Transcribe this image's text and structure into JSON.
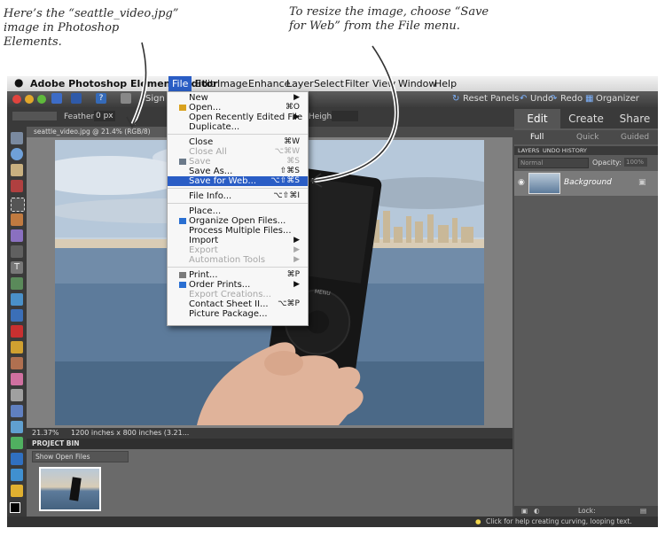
{
  "annotations": {
    "left": "Here’s the “seattle_video.jpg” image in Photoshop Elements.",
    "right": "To resize the image, choose “Save for Web” from the File menu."
  },
  "menubar": {
    "app_name": "Adobe Photoshop Elements Editor",
    "menus": [
      "File",
      "Edit",
      "Image",
      "Enhance",
      "Layer",
      "Select",
      "Filter",
      "View",
      "Window",
      "Help"
    ],
    "active_menu": "File"
  },
  "topbar": {
    "sign_in": "Sign In",
    "reset_panels": "Reset Panels",
    "undo": "Undo",
    "redo": "Redo",
    "organizer": "Organizer"
  },
  "options_bar": {
    "feather_label": "Feather:",
    "feather_value": "0 px",
    "height_label": "Height"
  },
  "document_tab": "seattle_video.jpg @ 21.4% (RGB/8)",
  "status": {
    "zoom": "21.37%",
    "dimensions": "1200 inches x 800 inches (3.21..."
  },
  "project_bin": {
    "title": "PROJECT BIN",
    "dropdown": "Show Open Files"
  },
  "right_panel": {
    "tabs": [
      "Edit",
      "Create",
      "Share"
    ],
    "subtabs": [
      "Full",
      "Quick",
      "Guided"
    ],
    "panel_tabs": [
      "LAYERS",
      "UNDO HISTORY"
    ],
    "blend_mode": "Normal",
    "opacity_label": "Opacity:",
    "opacity_value": "100%",
    "layer_name": "Background",
    "lock_label": "Lock:"
  },
  "bottom_status": "Click for help creating curving, looping text.",
  "file_menu": {
    "items": [
      {
        "label": "New",
        "shortcut": "▶",
        "state": "normal"
      },
      {
        "label": "Open...",
        "shortcut": "⌘O",
        "state": "normal"
      },
      {
        "label": "Open Recently Edited File",
        "shortcut": "▶",
        "state": "normal"
      },
      {
        "label": "Duplicate...",
        "shortcut": "",
        "state": "normal"
      },
      {
        "label": "Close",
        "shortcut": "⌘W",
        "state": "normal"
      },
      {
        "label": "Close All",
        "shortcut": "⌥⌘W",
        "state": "disabled"
      },
      {
        "label": "Save",
        "shortcut": "⌘S",
        "state": "disabled"
      },
      {
        "label": "Save As...",
        "shortcut": "⇧⌘S",
        "state": "normal"
      },
      {
        "label": "Save for Web...",
        "shortcut": "⌥⇧⌘S",
        "state": "highlighted"
      },
      {
        "label": "File Info...",
        "shortcut": "⌥⇧⌘I",
        "state": "normal"
      },
      {
        "label": "Place...",
        "shortcut": "",
        "state": "normal"
      },
      {
        "label": "Organize Open Files...",
        "shortcut": "",
        "state": "normal"
      },
      {
        "label": "Process Multiple Files...",
        "shortcut": "",
        "state": "normal"
      },
      {
        "label": "Import",
        "shortcut": "▶",
        "state": "normal"
      },
      {
        "label": "Export",
        "shortcut": "▶",
        "state": "disabled"
      },
      {
        "label": "Automation Tools",
        "shortcut": "▶",
        "state": "disabled"
      },
      {
        "label": "Print...",
        "shortcut": "⌘P",
        "state": "normal"
      },
      {
        "label": "Order Prints...",
        "shortcut": "▶",
        "state": "normal"
      },
      {
        "label": "Export Creations...",
        "shortcut": "",
        "state": "disabled"
      },
      {
        "label": "Contact Sheet II...",
        "shortcut": "⌥⌘P",
        "state": "normal"
      },
      {
        "label": "Picture Package...",
        "shortcut": "",
        "state": "normal"
      }
    ]
  },
  "photo": {
    "device_label": "MENU"
  },
  "colors": {
    "menu_highlight": "#2a5dc5",
    "panel_bg": "#5a5a5a",
    "canvas_bg": "#808080"
  }
}
